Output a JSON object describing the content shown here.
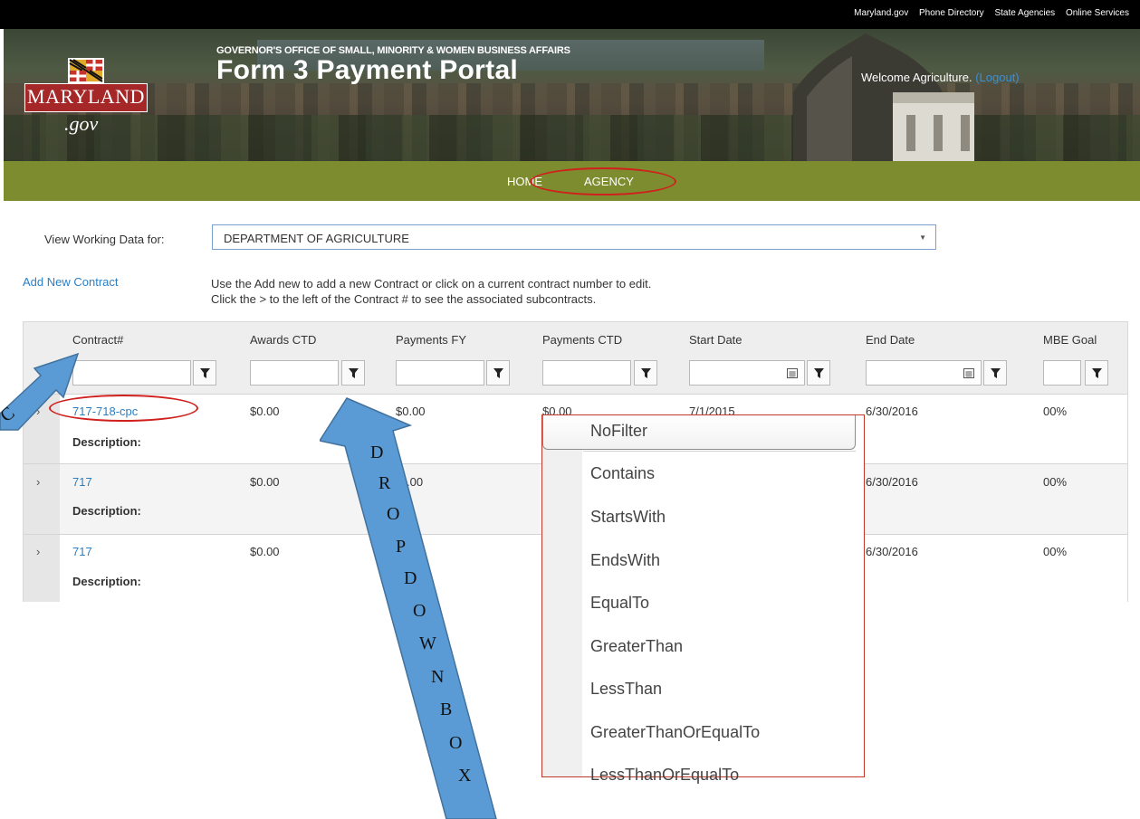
{
  "top_links": [
    "Maryland.gov",
    "Phone Directory",
    "State Agencies",
    "Online Services"
  ],
  "logo": {
    "state": "MARYLAND",
    "domain": ".gov"
  },
  "header": {
    "subtitle": "GOVERNOR'S OFFICE OF SMALL, MINORITY & WOMEN BUSINESS AFFAIRS",
    "title": "Form 3 Payment Portal",
    "welcome": "Welcome Agriculture.",
    "logout": "(Logout)"
  },
  "nav": {
    "home": "HOME",
    "agency": "AGENCY"
  },
  "view_working": {
    "label": "View Working Data for:",
    "selected": "DEPARTMENT OF AGRICULTURE"
  },
  "add_new_contract": "Add New Contract",
  "instructions": [
    "Use the Add new to add a new Contract or click on a current contract number to edit.",
    "Click the > to the left of the Contract # to see the associated subcontracts."
  ],
  "grid": {
    "columns": [
      "Contract#",
      "Awards CTD",
      "Payments FY",
      "Payments CTD",
      "Start Date",
      "End Date",
      "MBE Goal"
    ],
    "description_label": "Description:",
    "rows": [
      {
        "contract": "717-718-cpc",
        "awards": "$0.00",
        "payments_fy": "$0.00",
        "payments_ctd": "$0.00",
        "start": "7/1/2015",
        "end": "6/30/2016",
        "mbe": "00%"
      },
      {
        "contract": "717",
        "awards": "$0.00",
        "payments_fy": ".00",
        "end": "6/30/2016",
        "mbe": "00%"
      },
      {
        "contract": "717",
        "awards": "$0.00",
        "end": "6/30/2016",
        "mbe": "00%"
      }
    ]
  },
  "filter_menu": {
    "options": [
      "NoFilter",
      "Contains",
      "StartsWith",
      "EndsWith",
      "EqualTo",
      "GreaterThan",
      "LessThan",
      "GreaterThanOrEqualTo",
      "LessThanOrEqualTo"
    ]
  },
  "annotation": {
    "arrow_text": [
      "D",
      "R",
      "O",
      "P",
      "D",
      "O",
      "W",
      "N",
      "B",
      "O",
      "X"
    ],
    "left_arrow_letter": "C"
  },
  "colors": {
    "nav_green": "#7d8c2e",
    "link_blue": "#2a7fc4",
    "annotation_red": "#d0201d",
    "arrow_blue": "#5b9bd5"
  }
}
